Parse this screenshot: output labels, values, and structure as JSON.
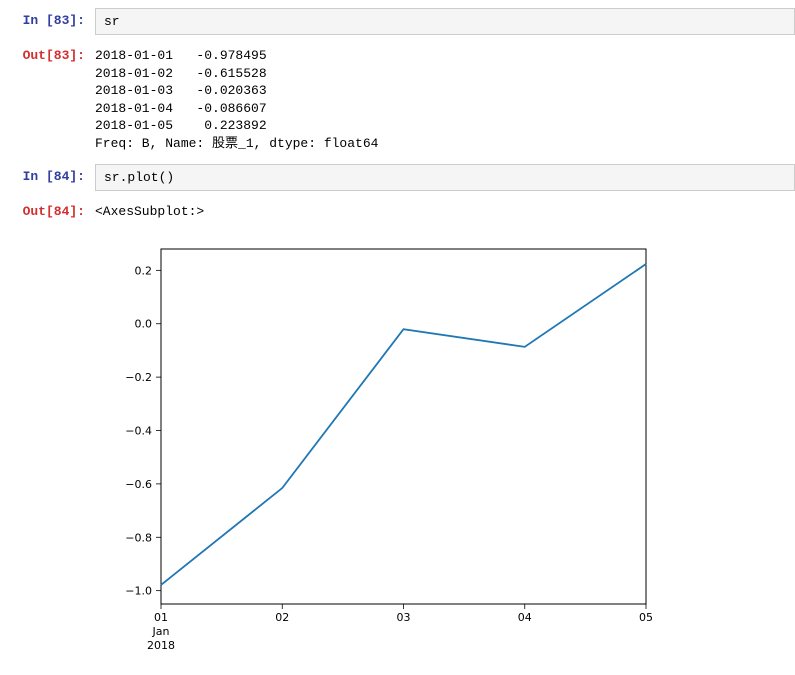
{
  "cell83": {
    "in_prompt": "In [83]:",
    "out_prompt": "Out[83]:",
    "code": "sr",
    "output_lines": [
      "2018-01-01   -0.978495",
      "2018-01-02   -0.615528",
      "2018-01-03   -0.020363",
      "2018-01-04   -0.086607",
      "2018-01-05    0.223892",
      "Freq: B, Name: 股票_1, dtype: float64"
    ]
  },
  "cell84": {
    "in_prompt": "In [84]:",
    "out_prompt": "Out[84]:",
    "code": "sr.plot()",
    "output_repr": "<AxesSubplot:>"
  },
  "chart_data": {
    "type": "line",
    "x": [
      1,
      2,
      3,
      4,
      5
    ],
    "x_labels": [
      "01",
      "02",
      "03",
      "04",
      "05"
    ],
    "x_sublabels": [
      "Jan",
      "2018"
    ],
    "values": [
      -0.978495,
      -0.615528,
      -0.020363,
      -0.086607,
      0.223892
    ],
    "y_ticks": [
      -1.0,
      -0.8,
      -0.6,
      -0.4,
      -0.2,
      0.0,
      0.2
    ],
    "y_tick_labels": [
      "−1.0",
      "−0.8",
      "−0.6",
      "−0.4",
      "−0.2",
      "0.0",
      "0.2"
    ],
    "ylim": [
      -1.05,
      0.28
    ],
    "xlim": [
      1,
      5
    ],
    "line_color": "#1f77b4"
  }
}
